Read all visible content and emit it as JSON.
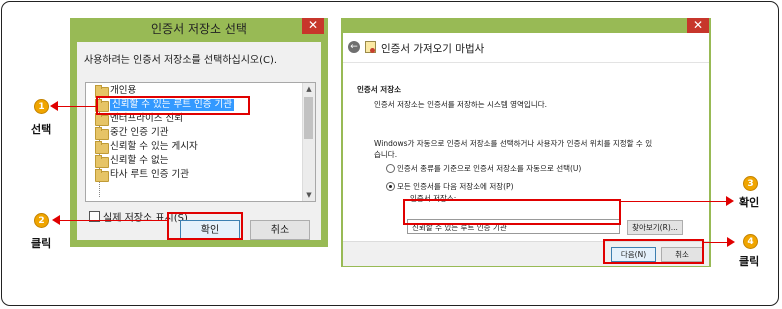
{
  "store_dialog": {
    "title": "인증서 저장소 선택",
    "close_label": "✕",
    "prompt": "사용하려는 인증서 저장소를 선택하십시오(C).",
    "stores": [
      "개인용",
      "신뢰할 수 있는 루트 인증 기관",
      "엔터프라이즈 신뢰",
      "중간 인증 기관",
      "신뢰할 수 있는 게시자",
      "신뢰할 수 없는",
      "타사 루트 인증 기관"
    ],
    "selected_index": 1,
    "show_physical_label": "실제 저장소 표시(S)",
    "show_physical_checked": false,
    "ok_label": "확인",
    "cancel_label": "취소"
  },
  "import_wizard": {
    "title": "인증서 가져오기 마법사",
    "close_label": "✕",
    "section_title": "인증서 저장소",
    "section_desc": "인증서 저장소는 인증서를 저장하는 시스템 영역입니다.",
    "info_line1": "Windows가 자동으로 인증서 저장소를 선택하거나 사용자가 인증서 위치를 지정할 수 있",
    "info_line2": "습니다.",
    "radio_auto": "인증서 종류를 기준으로 인증서 저장소를 자동으로 선택(U)",
    "radio_manual": "모든 인증서를 다음 저장소에 저장(P)",
    "selected_radio": "manual",
    "store_field_label": "인증서 저장소:",
    "store_field_value": "신뢰할 수 있는 루트 인증 기관",
    "browse_label": "찾아보기(R)...",
    "next_label": "다음(N)",
    "cancel_label": "취소"
  },
  "callouts": [
    {
      "number": "1",
      "text": "선택"
    },
    {
      "number": "2",
      "text": "클릭"
    },
    {
      "number": "3",
      "text": "확인"
    },
    {
      "number": "4",
      "text": "클릭"
    }
  ],
  "colors": {
    "window_frame": "#98ba55",
    "highlight": "#e00000",
    "selection": "#3399ff",
    "badge": "#f0a500"
  }
}
